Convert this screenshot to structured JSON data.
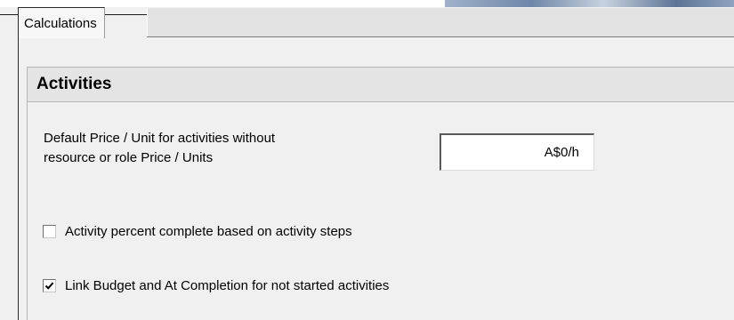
{
  "tabs": [
    {
      "label": "Calculations",
      "selected": true
    }
  ],
  "section": {
    "title": "Activities"
  },
  "default_price": {
    "label": "Default Price / Unit for activities without resource or role Price / Units",
    "label_line1": "Default Price / Unit for activities without",
    "label_line2": "resource or role Price / Units",
    "value": "A$0/h"
  },
  "options": [
    {
      "label": "Activity percent complete based on activity steps",
      "checked": false
    },
    {
      "label": "Link Budget and At Completion for not started activities",
      "checked": true
    }
  ],
  "icons": {
    "check": "check-icon"
  }
}
